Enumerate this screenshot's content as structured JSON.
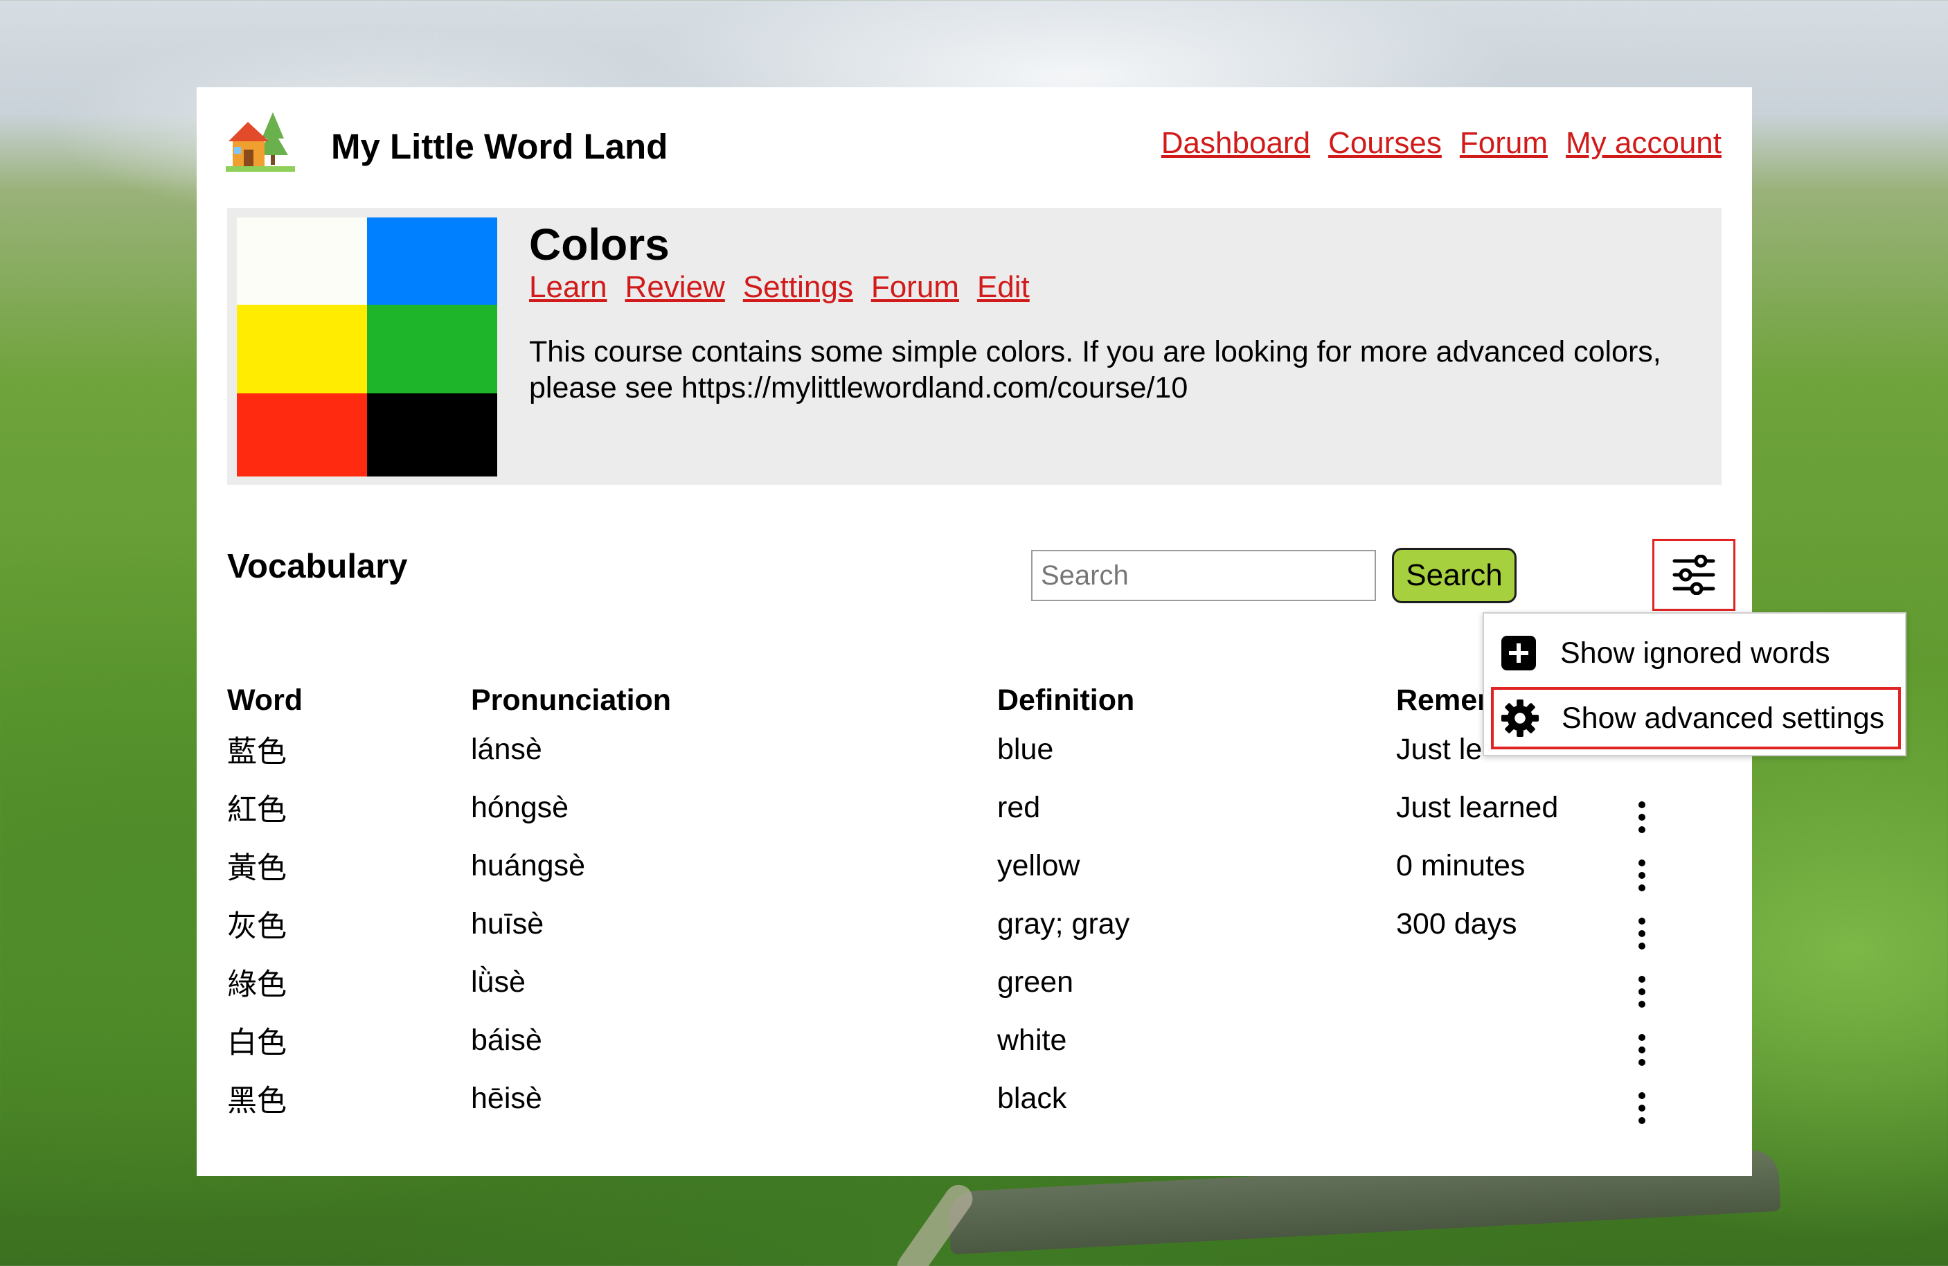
{
  "app": {
    "title": "My Little Word Land",
    "logo_icon": "house-tree-icon"
  },
  "nav": {
    "items": [
      {
        "label": "Dashboard"
      },
      {
        "label": "Courses"
      },
      {
        "label": "Forum"
      },
      {
        "label": "My account"
      }
    ]
  },
  "course": {
    "title": "Colors",
    "swatches": [
      "#fdfdf7",
      "#0080ff",
      "#ffec00",
      "#1fb52a",
      "#ff2a0f",
      "#000000"
    ],
    "links": [
      {
        "label": "Learn"
      },
      {
        "label": "Review"
      },
      {
        "label": "Settings"
      },
      {
        "label": "Forum"
      },
      {
        "label": "Edit"
      }
    ],
    "description": "This course contains some simple colors. If you are looking for more advanced colors, please see https://mylittlewordland.com/course/10"
  },
  "vocabulary": {
    "title": "Vocabulary",
    "search_placeholder": "Search",
    "search_button": "Search",
    "filter_icon": "sliders-icon",
    "columns": {
      "word": "Word",
      "pronunciation": "Pronunciation",
      "definition": "Definition",
      "remember": "Remer"
    },
    "rows": [
      {
        "word": "藍色",
        "pronunciation": "lánsè",
        "definition": "blue",
        "remember": "Just le"
      },
      {
        "word": "紅色",
        "pronunciation": "hóngsè",
        "definition": "red",
        "remember": "Just learned"
      },
      {
        "word": "黃色",
        "pronunciation": "huángsè",
        "definition": "yellow",
        "remember": "0 minutes"
      },
      {
        "word": "灰色",
        "pronunciation": "huīsè",
        "definition": "gray; gray",
        "remember": "300 days"
      },
      {
        "word": "綠色",
        "pronunciation": "lǜsè",
        "definition": "green",
        "remember": ""
      },
      {
        "word": "白色",
        "pronunciation": "báisè",
        "definition": "white",
        "remember": ""
      },
      {
        "word": "黑色",
        "pronunciation": "hēisè",
        "definition": "black",
        "remember": ""
      }
    ]
  },
  "dropdown": {
    "items": [
      {
        "label": "Show ignored words",
        "icon": "plus-square-icon"
      },
      {
        "label": "Show advanced settings",
        "icon": "gear-icon"
      }
    ]
  },
  "colors": {
    "link": "#d11a1a",
    "highlight_border": "#e02424",
    "search_button": "#a6d03e",
    "course_box": "#ececec"
  }
}
